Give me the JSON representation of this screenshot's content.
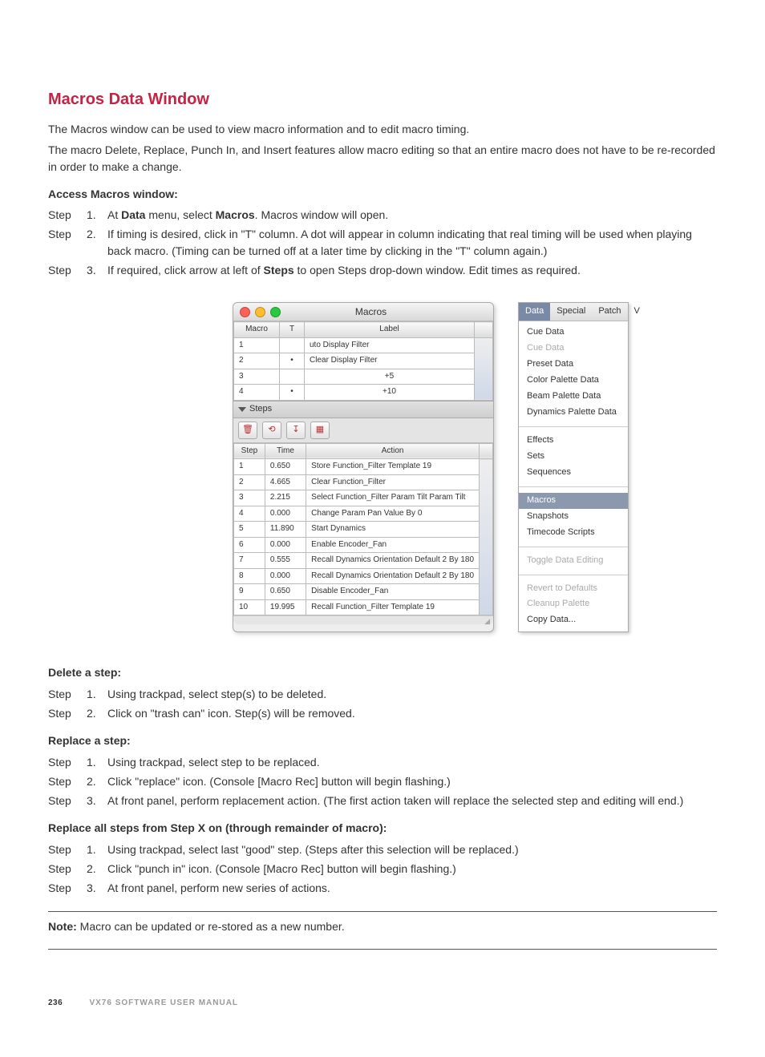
{
  "section": {
    "title": "Macros Data Window",
    "intro1": "The Macros window can be used to view macro information and to edit macro timing.",
    "intro2": "The macro Delete, Replace, Punch In, and Insert features allow macro editing so that an entire macro does not have to be re-recorded in order to make a change."
  },
  "access": {
    "heading": "Access Macros window:",
    "steps": [
      {
        "n": "1.",
        "pre": "At ",
        "b1": "Data",
        "mid": " menu, select ",
        "b2": "Macros",
        "post": ". Macros window will open."
      },
      {
        "n": "2.",
        "text": "If timing is desired, click in \"T\" column. A dot will appear in column indicating that real timing will be used when playing back macro. (Timing can be turned off at a later time by clicking in the \"T\" column again.)"
      },
      {
        "n": "3.",
        "pre": "If required, click arrow at left of ",
        "b1": "Steps",
        "post": " to open Steps drop-down window. Edit times as required."
      }
    ]
  },
  "macwin": {
    "title": "Macros",
    "topHeaders": {
      "macro": "Macro",
      "t": "T",
      "label": "Label"
    },
    "topRows": [
      {
        "macro": "1",
        "t": "",
        "label": "uto Display Filter"
      },
      {
        "macro": "2",
        "t": "•",
        "label": "Clear Display Filter"
      },
      {
        "macro": "3",
        "t": "",
        "label": "+5"
      },
      {
        "macro": "4",
        "t": "•",
        "label": "+10"
      }
    ],
    "stepsLabel": "Steps",
    "stepHeaders": {
      "step": "Step",
      "time": "Time",
      "action": "Action"
    },
    "stepRows": [
      {
        "step": "1",
        "time": "0.650",
        "action": "Store Function_Filter Template 19"
      },
      {
        "step": "2",
        "time": "4.665",
        "action": "Clear Function_Filter"
      },
      {
        "step": "3",
        "time": "2.215",
        "action": "Select Function_Filter Param Tilt Param Tilt"
      },
      {
        "step": "4",
        "time": "0.000",
        "action": "Change Param Pan Value By 0"
      },
      {
        "step": "5",
        "time": "11.890",
        "action": "Start Dynamics"
      },
      {
        "step": "6",
        "time": "0.000",
        "action": "Enable Encoder_Fan"
      },
      {
        "step": "7",
        "time": "0.555",
        "action": "Recall Dynamics Orientation Default 2 By 180"
      },
      {
        "step": "8",
        "time": "0.000",
        "action": "Recall Dynamics Orientation Default 2 By 180"
      },
      {
        "step": "9",
        "time": "0.650",
        "action": "Disable Encoder_Fan"
      },
      {
        "step": "10",
        "time": "19.995",
        "action": "Recall Function_Filter Template 19"
      }
    ]
  },
  "datamenu": {
    "bar": {
      "data": "Data",
      "special": "Special",
      "patch": "Patch",
      "v": "V"
    },
    "items1": [
      "Cue Data",
      "Cue Data",
      "Preset Data",
      "Color Palette Data",
      "Beam Palette Data",
      "Dynamics Palette Data"
    ],
    "items2": [
      "Effects",
      "Sets",
      "Sequences"
    ],
    "macros": "Macros",
    "items3": [
      "Snapshots",
      "Timecode Scripts"
    ],
    "toggle": "Toggle Data Editing",
    "items4": [
      "Revert to Defaults",
      "Cleanup Palette",
      "Copy Data..."
    ]
  },
  "delete": {
    "heading": "Delete a step:",
    "steps": [
      {
        "n": "1.",
        "text": "Using trackpad, select step(s) to be deleted."
      },
      {
        "n": "2.",
        "text": "Click on \"trash can\" icon.  Step(s) will be removed."
      }
    ]
  },
  "replace": {
    "heading": "Replace a step:",
    "steps": [
      {
        "n": "1.",
        "text": "Using trackpad, select step to be replaced."
      },
      {
        "n": "2.",
        "text": "Click \"replace\" icon.  (Console [Macro Rec] button will begin flashing.)"
      },
      {
        "n": "3.",
        "text": "At front panel, perform replacement action. (The first action taken will replace the selected step and editing will end.)"
      }
    ]
  },
  "replaceAll": {
    "heading": "Replace all steps from Step X on (through remainder of macro):",
    "steps": [
      {
        "n": "1.",
        "text": "Using trackpad, select last \"good\" step.  (Steps after this selection will be replaced.)"
      },
      {
        "n": "2.",
        "text": "Click \"punch in\" icon.  (Console [Macro Rec] button will begin flashing.)"
      },
      {
        "n": "3.",
        "text": "At front panel, perform new series of actions."
      }
    ]
  },
  "note": {
    "label": "Note:",
    "text": "  Macro can be updated or re-stored as a new number."
  },
  "footer": {
    "page": "236",
    "manual": "VX76 SOFTWARE USER MANUAL"
  },
  "stepWord": "Step"
}
